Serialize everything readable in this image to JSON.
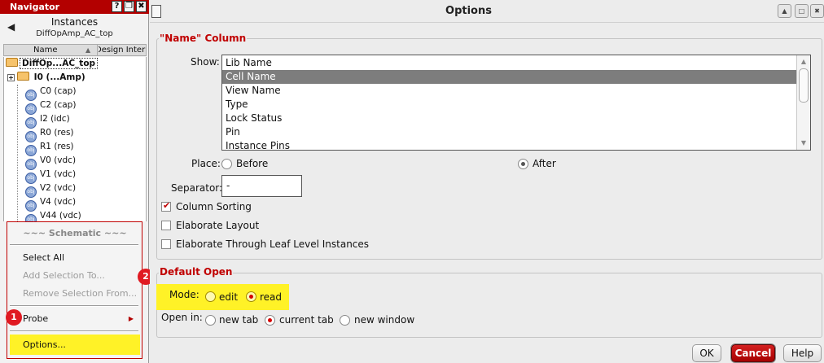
{
  "navigator": {
    "window_title": "Navigator",
    "titlebar_buttons": [
      "?",
      "❐",
      "✖"
    ],
    "back_icon": "◀",
    "panel_title": "Instances",
    "panel_subtitle": "DiffOpAmp_AC_top",
    "columns": {
      "name": "Name",
      "design": "Design Inter",
      "sort_icon": "▲"
    },
    "tree": {
      "root": "DiffOp...AC_top",
      "expand_icon": "+",
      "i0": "I0 (...Amp)",
      "obj_icon_text": "obj",
      "instances": [
        "C0 (cap)",
        "C2 (cap)",
        "I2 (idc)",
        "R0 (res)",
        "R1 (res)",
        "V0 (vdc)",
        "V1 (vdc)",
        "V2 (vdc)",
        "V4 (vdc)",
        "V44 (vdc)"
      ]
    },
    "context_menu": {
      "heading": "~~~ Schematic ~~~",
      "select_all": "Select All",
      "add_selection": "Add Selection To...",
      "remove_selection": "Remove Selection From...",
      "probe": "Probe",
      "submenu_icon": "▶",
      "options": "Options..."
    }
  },
  "badges": {
    "one": "1",
    "two": "2"
  },
  "dialog": {
    "title": "Options",
    "window_buttons": [
      "▲",
      "□",
      "✖"
    ],
    "name_column": {
      "group_title": "\"Name\" Column",
      "show_label": "Show:",
      "show_items": [
        "Lib Name",
        "Cell Name",
        "View Name",
        "Type",
        "Lock Status",
        "Pin",
        "Instance Pins"
      ],
      "selected_item": "Cell Name",
      "scroll_up_icon": "▲",
      "scroll_down_icon": "▼",
      "place_label": "Place:",
      "place_before": "Before",
      "place_after": "After",
      "place_selected": "After",
      "separator_label": "Separator:",
      "separator_value": "-",
      "column_sorting": "Column Sorting",
      "column_sorting_checked": true,
      "check_icon": "✔",
      "elaborate_layout": "Elaborate Layout",
      "elaborate_leaf": "Elaborate Through Leaf Level Instances"
    },
    "default_open": {
      "group_title": "Default Open",
      "mode_label": "Mode:",
      "mode_edit": "edit",
      "mode_read": "read",
      "mode_selected": "read",
      "open_in_label": "Open in:",
      "open_new_tab": "new tab",
      "open_current_tab": "current tab",
      "open_new_window": "new window",
      "open_in_selected": "current tab"
    },
    "buttons": {
      "ok": "OK",
      "cancel": "Cancel",
      "help": "Help"
    }
  },
  "colors": {
    "accent_red": "#c00000",
    "highlight_yellow": "#fff227",
    "badge_red": "#e01a22"
  }
}
